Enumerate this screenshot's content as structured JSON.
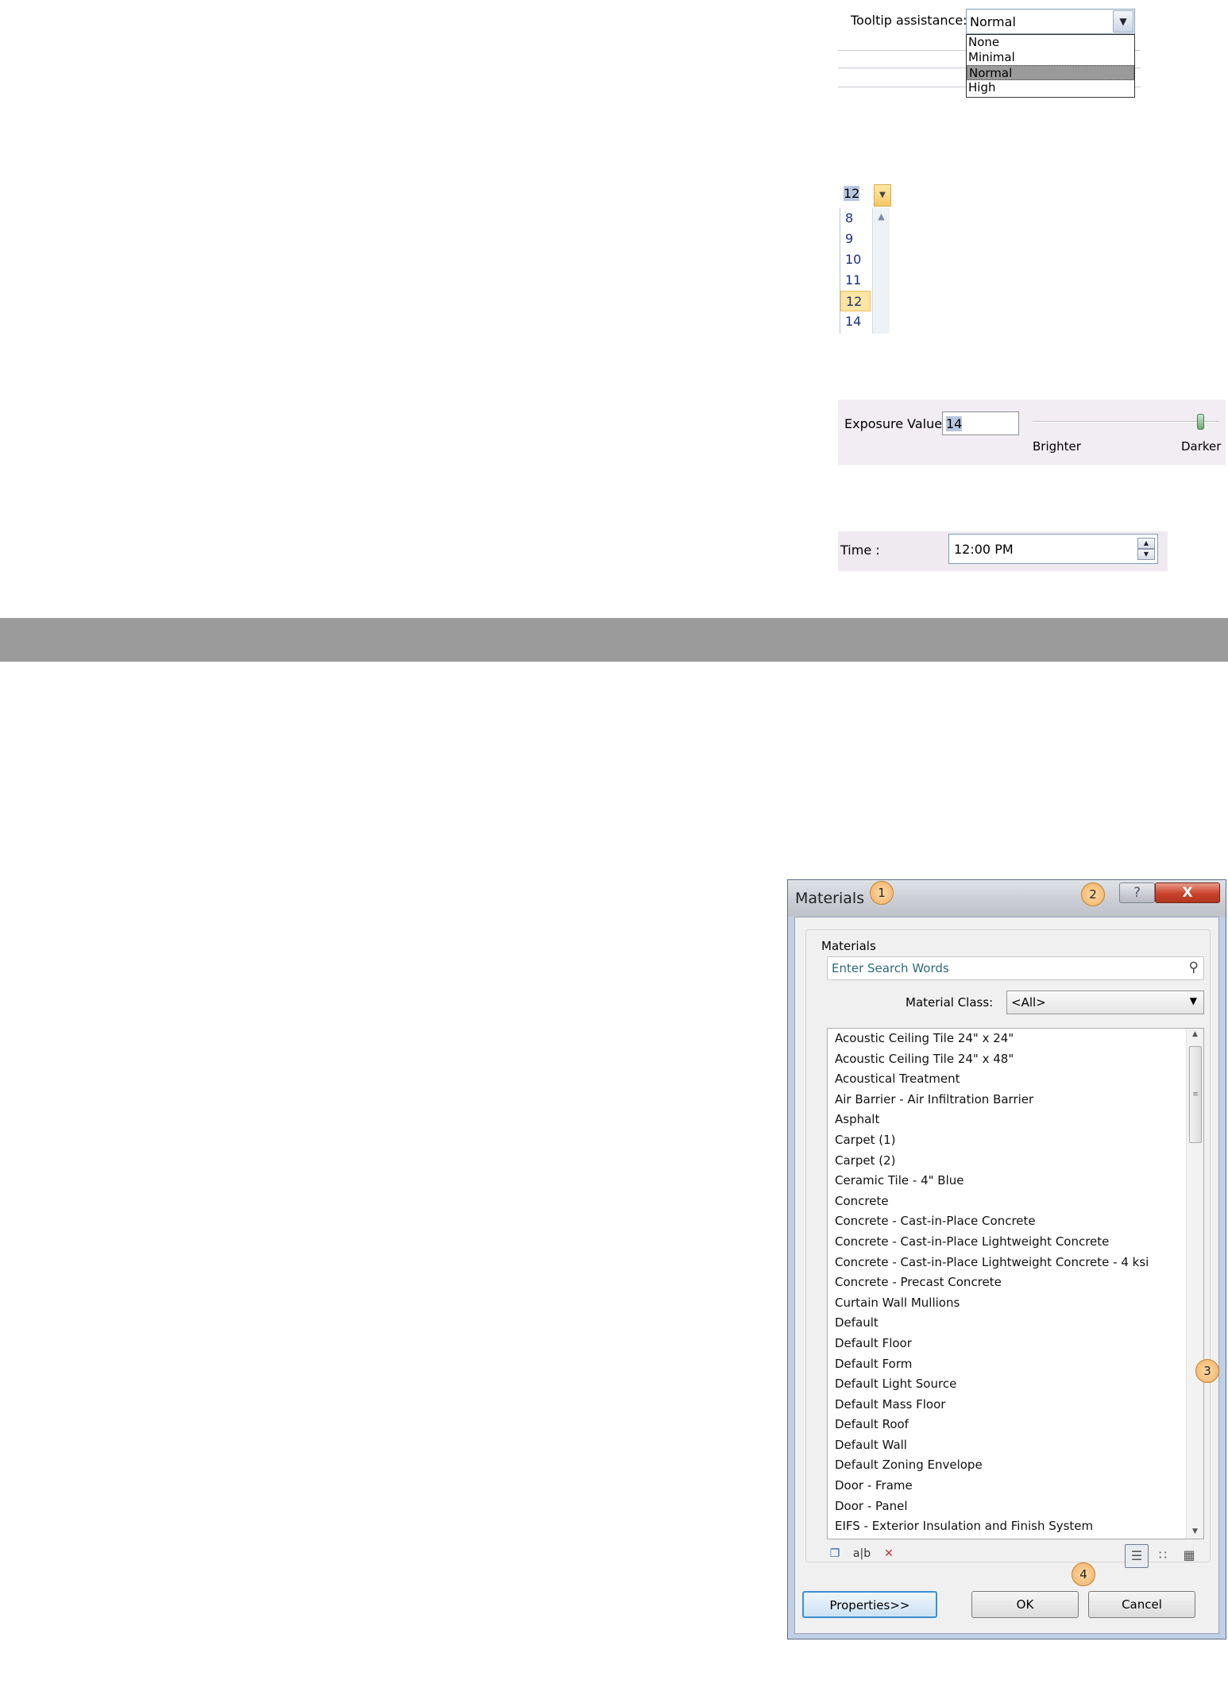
{
  "tooltip": {
    "label": "Tooltip assistance:",
    "selected": "Normal",
    "options": [
      "None",
      "Minimal",
      "Normal",
      "High"
    ]
  },
  "font_size": {
    "selected": "12",
    "options": [
      "8",
      "9",
      "10",
      "11",
      "12",
      "14"
    ]
  },
  "exposure": {
    "label": "Exposure Value:",
    "value": "14",
    "brighter_label": "Brighter",
    "darker_label": "Darker",
    "slider_level": 0.9
  },
  "time": {
    "label": "Time :",
    "value": "12:00 PM"
  },
  "materials_dialog": {
    "title": "Materials",
    "callouts": [
      "1",
      "2",
      "3",
      "4"
    ],
    "help_glyph": "?",
    "close_glyph": "X",
    "group_title": "Materials",
    "search_placeholder": "Enter Search Words",
    "material_class_label": "Material Class:",
    "material_class_value": "<All>",
    "items": [
      "Acoustic Ceiling Tile 24\" x 24\"",
      "Acoustic Ceiling Tile 24\" x 48\"",
      "Acoustical Treatment",
      "Air Barrier - Air Infiltration Barrier",
      "Asphalt",
      "Carpet (1)",
      "Carpet (2)",
      "Ceramic Tile - 4\" Blue",
      "Concrete",
      "Concrete - Cast-in-Place Concrete",
      "Concrete - Cast-in-Place Lightweight Concrete",
      "Concrete - Cast-in-Place Lightweight Concrete - 4 ksi",
      "Concrete - Precast Concrete",
      "Curtain Wall Mullions",
      "Default",
      "Default Floor",
      "Default Form",
      "Default Light Source",
      "Default Mass Floor",
      "Default Roof",
      "Default Wall",
      "Default Zoning Envelope",
      "Door - Frame",
      "Door - Panel",
      "EIFS - Exterior Insulation and Finish System"
    ],
    "properties_label": "Properties>>",
    "ok_label": "OK",
    "cancel_label": "Cancel"
  }
}
